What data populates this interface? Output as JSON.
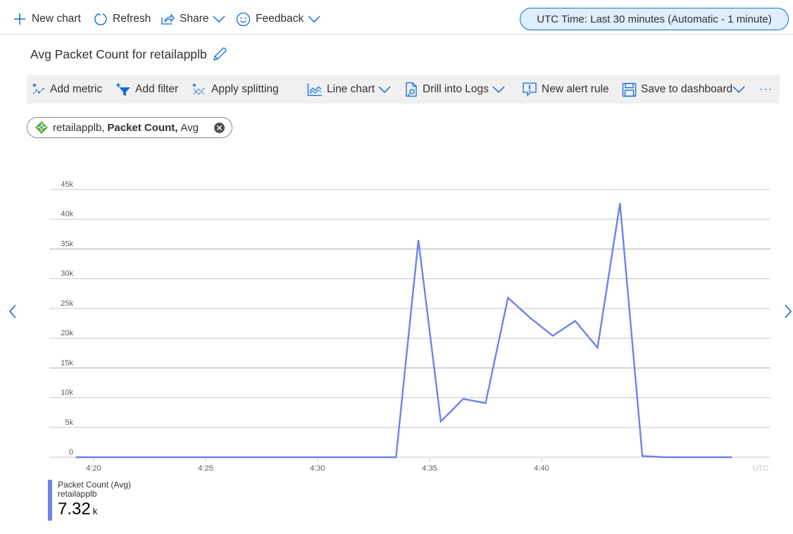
{
  "topbar": {
    "new_chart": "New chart",
    "refresh": "Refresh",
    "share": "Share",
    "feedback": "Feedback",
    "time_range": "UTC Time: Last 30 minutes (Automatic - 1 minute)"
  },
  "chart_title": "Avg Packet Count for retailapplb",
  "toolbar": {
    "add_metric": "Add metric",
    "add_filter": "Add filter",
    "apply_splitting": "Apply splitting",
    "line_chart": "Line chart",
    "drill_into_logs": "Drill into Logs",
    "new_alert_rule": "New alert rule",
    "save_to_dashboard": "Save to dashboard",
    "more": "···"
  },
  "metric_pill": {
    "resource": "retailapplb,",
    "metric": "Packet Count,",
    "aggregation": "Avg"
  },
  "legend": {
    "title": "Packet Count (Avg)",
    "resource": "retailapplb",
    "value": "7.32",
    "unit": "k"
  },
  "colors": {
    "series": "#6d82ee",
    "accent": "#0a6dd9",
    "pill_bg": "#ddeefe",
    "toolbar_bg": "#f0f0f0",
    "grid": "#c8c8c8"
  },
  "chart_data": {
    "type": "line",
    "title": "Avg Packet Count for retailapplb",
    "xlabel": "",
    "ylabel": "",
    "timezone_label": "UTC",
    "ylim": [
      0,
      45000
    ],
    "y_ticks": [
      0,
      5000,
      10000,
      15000,
      20000,
      25000,
      30000,
      35000,
      40000,
      45000
    ],
    "y_tick_labels": [
      "0",
      "5k",
      "10k",
      "15k",
      "20k",
      "25k",
      "30k",
      "35k",
      "40k",
      "45k"
    ],
    "x_range_minutes": [
      19.0,
      49.5
    ],
    "x_ticks": [
      20,
      25,
      30,
      35,
      40
    ],
    "x_tick_labels": [
      "4:20",
      "4:25",
      "4:30",
      "4:35",
      "4:40"
    ],
    "grid": true,
    "legend_position": "bottom-left",
    "series": [
      {
        "name": "Packet Count (Avg) retailapplb",
        "x_minutes": [
          19.2,
          20.5,
          21.5,
          22.5,
          23.5,
          24.5,
          25.5,
          26.5,
          27.5,
          28.5,
          29.5,
          30.5,
          31.5,
          32.5,
          33.5,
          34.5,
          35.5,
          36.5,
          37.5,
          38.5,
          39.5,
          40.5,
          41.5,
          42.5,
          43.5,
          44.5,
          45.5,
          46.5,
          47.5,
          48.5
        ],
        "values": [
          0,
          0,
          0,
          0,
          0,
          0,
          0,
          0,
          0,
          0,
          0,
          0,
          0,
          0,
          0,
          36500,
          6000,
          9800,
          9100,
          26800,
          23400,
          20400,
          22900,
          18400,
          42700,
          200,
          0,
          0,
          0,
          0
        ]
      }
    ]
  }
}
